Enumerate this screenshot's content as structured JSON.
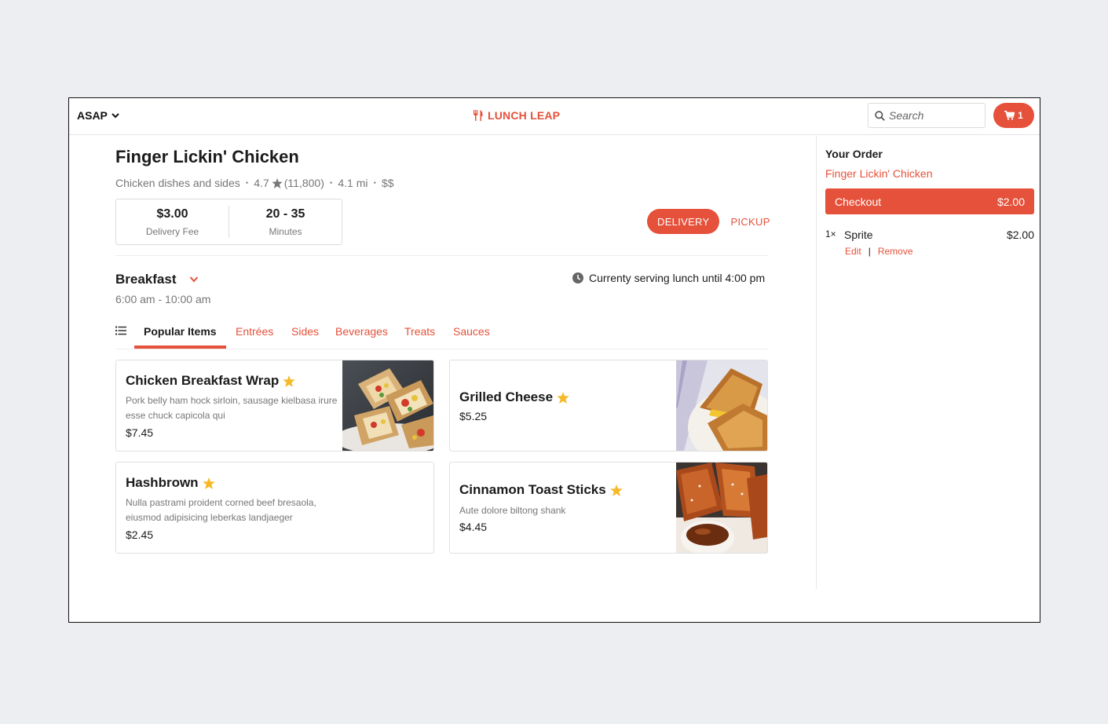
{
  "header": {
    "time_label": "ASAP",
    "brand_name": "LUNCH LEAP",
    "search_placeholder": "Search",
    "cart_count": "1"
  },
  "restaurant": {
    "name": "Finger Lickin' Chicken",
    "cuisine": "Chicken dishes and sides",
    "rating": "4.7",
    "review_count": "(11,800)",
    "distance": "4.1 mi",
    "price_level": "$$",
    "delivery_fee": "$3.00",
    "delivery_fee_label": "Delivery Fee",
    "eta": "20 - 35",
    "eta_label": "Minutes",
    "delivery_label": "DELIVERY",
    "pickup_label": "PICKUP"
  },
  "menu": {
    "title": "Breakfast",
    "hours": "6:00 am - 10:00 am",
    "serving_note": "Currenty serving lunch until 4:00 pm",
    "tabs": [
      "Popular Items",
      "Entrées",
      "Sides",
      "Beverages",
      "Treats",
      "Sauces"
    ],
    "active_tab": "Popular Items"
  },
  "items": [
    {
      "name": "Chicken Breakfast Wrap",
      "description": "Pork belly ham hock sirloin, sausage kielbasa irure esse chuck capicola qui",
      "price": "$7.45",
      "popular": true
    },
    {
      "name": "Grilled Cheese",
      "description": "",
      "price": "$5.25",
      "popular": true
    },
    {
      "name": "Hashbrown",
      "description": "Nulla pastrami proident corned beef bresaola, eiusmod adipisicing leberkas landjaeger",
      "price": "$2.45",
      "popular": true
    },
    {
      "name": "Cinnamon Toast Sticks",
      "description": "Aute dolore biltong shank",
      "price": "$4.45",
      "popular": true
    }
  ],
  "order": {
    "title": "Your Order",
    "restaurant": "Finger Lickin' Chicken",
    "checkout_label": "Checkout",
    "checkout_total": "$2.00",
    "line_items": [
      {
        "qty": "1×",
        "name": "Sprite",
        "price": "$2.00",
        "edit_label": "Edit",
        "separator": "|",
        "remove_label": "Remove"
      }
    ]
  },
  "colors": {
    "accent": "#e5513a",
    "star": "#f7b928",
    "text": "#1b1b1b",
    "muted": "#777777"
  },
  "icons": {
    "time_selector": "chevron-down-icon",
    "brand": "utensils-icon",
    "search": "search-icon",
    "cart": "cart-icon",
    "rating": "star-icon",
    "menu_toggle": "chevron-down-icon",
    "serving": "clock-icon",
    "tab_list": "list-icon",
    "popular": "star-icon"
  }
}
